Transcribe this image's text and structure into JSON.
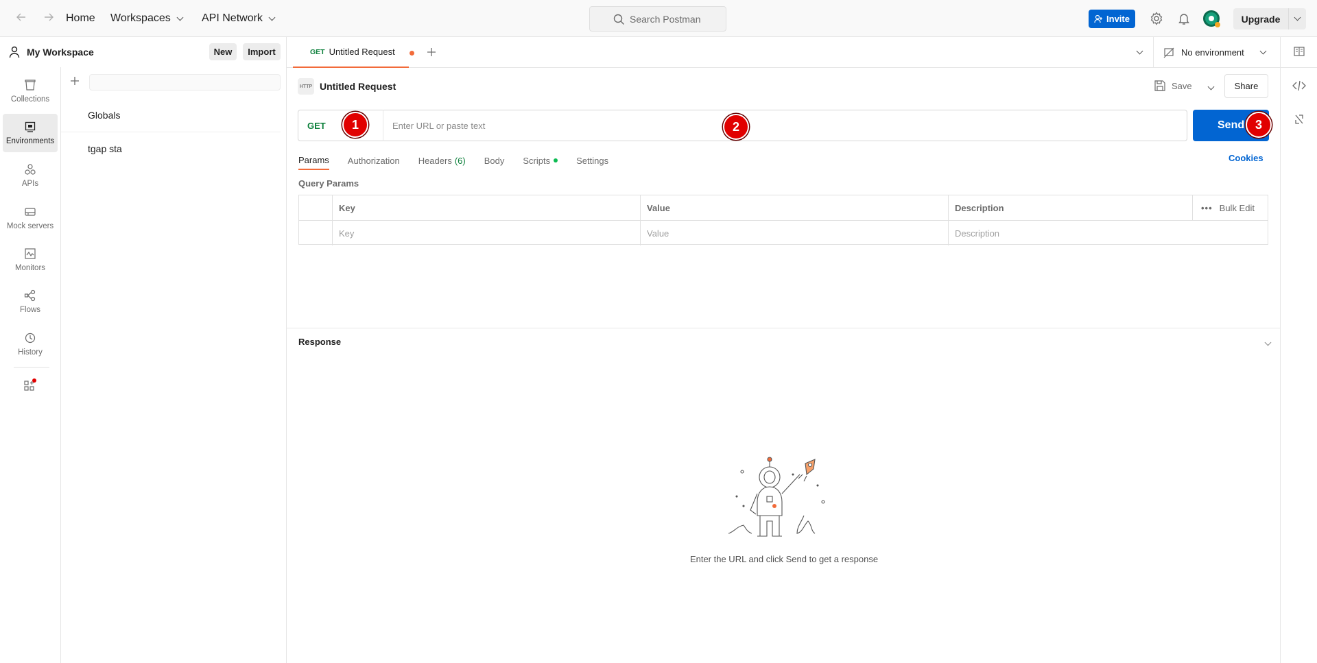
{
  "topbar": {
    "back_icon": "arrow-left-icon",
    "forward_icon": "arrow-right-icon",
    "home": "Home",
    "workspaces": "Workspaces",
    "api_network": "API Network",
    "search_placeholder": "Search Postman",
    "invite": "Invite",
    "upgrade": "Upgrade"
  },
  "workspace": {
    "title": "My Workspace",
    "new_button": "New",
    "import_button": "Import"
  },
  "rail": {
    "items": [
      {
        "label": "Collections",
        "icon": "collections-icon"
      },
      {
        "label": "Environments",
        "icon": "environments-icon",
        "active": true
      },
      {
        "label": "APIs",
        "icon": "apis-icon"
      },
      {
        "label": "Mock servers",
        "icon": "mock-servers-icon"
      },
      {
        "label": "Monitors",
        "icon": "monitors-icon"
      },
      {
        "label": "Flows",
        "icon": "flows-icon"
      },
      {
        "label": "History",
        "icon": "history-icon"
      }
    ]
  },
  "environments": {
    "items": [
      "Globals",
      "tgap sta"
    ]
  },
  "tab": {
    "method": "GET",
    "title": "Untitled Request"
  },
  "env_selector": "No environment",
  "request": {
    "title": "Untitled Request",
    "badge": "HTTP",
    "save": "Save",
    "share": "Share",
    "method": "GET",
    "url_placeholder": "Enter URL or paste text",
    "send": "Send",
    "tabs": {
      "params": "Params",
      "authorization": "Authorization",
      "headers": "Headers",
      "headers_count": "(6)",
      "body": "Body",
      "scripts": "Scripts",
      "settings": "Settings"
    },
    "cookies": "Cookies",
    "query_params_label": "Query Params",
    "table": {
      "headers": [
        "Key",
        "Value",
        "Description"
      ],
      "bulk_edit": "Bulk Edit",
      "placeholders": [
        "Key",
        "Value",
        "Description"
      ]
    }
  },
  "markers": [
    "1",
    "2",
    "3"
  ],
  "response": {
    "title": "Response",
    "empty_message": "Enter the URL and click Send to get a response"
  },
  "colors": {
    "accent_orange": "#f26b3a",
    "primary_blue": "#0265d2",
    "method_green": "#0b7f3a",
    "marker_red": "#e10000"
  }
}
